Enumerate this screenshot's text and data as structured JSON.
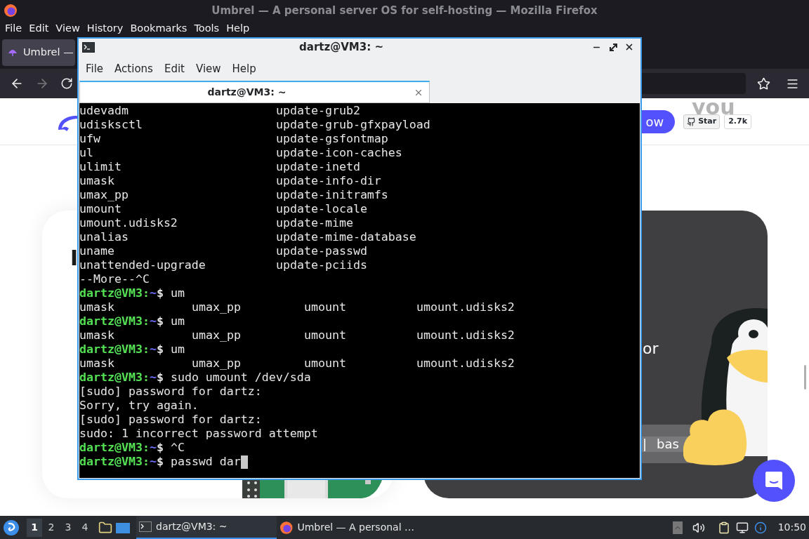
{
  "browser": {
    "title": "Umbrel — A personal server OS for self-hosting — Mozilla Firefox",
    "menu": [
      "File",
      "Edit",
      "View",
      "History",
      "Bookmarks",
      "Tools",
      "Help"
    ],
    "tab": {
      "label": "Umbrel —",
      "selected": true
    },
    "page": {
      "header": {
        "tagline": "you",
        "button": "ow",
        "star": "Star",
        "star_count": "2.7k"
      },
      "left_card": {
        "heading": [
          "I"
        ]
      },
      "right_card": {
        "text": "or",
        "command_bar": [
          "|",
          "bas"
        ]
      }
    }
  },
  "terminal": {
    "title": "dartz@VM3: ~",
    "menu": [
      "File",
      "Actions",
      "Edit",
      "View",
      "Help"
    ],
    "tab": {
      "label": "dartz@VM3: ~",
      "selected": true
    },
    "lines": [
      {
        "kind": "columns",
        "cells": [
          "udevadm",
          "update-grub2"
        ]
      },
      {
        "kind": "columns",
        "cells": [
          "udisksctl",
          "update-grub-gfxpayload"
        ]
      },
      {
        "kind": "columns",
        "cells": [
          "ufw",
          "update-gsfontmap"
        ]
      },
      {
        "kind": "columns",
        "cells": [
          "ul",
          "update-icon-caches"
        ]
      },
      {
        "kind": "columns",
        "cells": [
          "ulimit",
          "update-inetd"
        ]
      },
      {
        "kind": "columns",
        "cells": [
          "umask",
          "update-info-dir"
        ]
      },
      {
        "kind": "columns",
        "cells": [
          "umax_pp",
          "update-initramfs"
        ]
      },
      {
        "kind": "columns",
        "cells": [
          "umount",
          "update-locale"
        ]
      },
      {
        "kind": "columns",
        "cells": [
          "umount.udisks2",
          "update-mime"
        ]
      },
      {
        "kind": "columns",
        "cells": [
          "unalias",
          "update-mime-database"
        ]
      },
      {
        "kind": "columns",
        "cells": [
          "uname",
          "update-passwd"
        ]
      },
      {
        "kind": "columns",
        "cells": [
          "unattended-upgrade",
          "update-pciids"
        ]
      },
      {
        "kind": "output",
        "text": "--More--^C"
      },
      {
        "kind": "prompt",
        "host": "dartz@VM3:",
        "path": "~",
        "sign": "$",
        "command": "um"
      },
      {
        "kind": "columns",
        "cells": [
          "umask",
          "umax_pp",
          "umount",
          "umount.udisks2"
        ]
      },
      {
        "kind": "prompt",
        "host": "dartz@VM3:",
        "path": "~",
        "sign": "$",
        "command": "um"
      },
      {
        "kind": "columns",
        "cells": [
          "umask",
          "umax_pp",
          "umount",
          "umount.udisks2"
        ]
      },
      {
        "kind": "prompt",
        "host": "dartz@VM3:",
        "path": "~",
        "sign": "$",
        "command": "um"
      },
      {
        "kind": "columns",
        "cells": [
          "umask",
          "umax_pp",
          "umount",
          "umount.udisks2"
        ]
      },
      {
        "kind": "prompt",
        "host": "dartz@VM3:",
        "path": "~",
        "sign": "$",
        "command": "sudo umount /dev/sda"
      },
      {
        "kind": "output",
        "text": "[sudo] password for dartz:"
      },
      {
        "kind": "output",
        "text": "Sorry, try again."
      },
      {
        "kind": "output",
        "text": "[sudo] password for dartz:"
      },
      {
        "kind": "output",
        "text": "sudo: 1 incorrect password attempt"
      },
      {
        "kind": "prompt",
        "host": "dartz@VM3:",
        "path": "~",
        "sign": "$",
        "command": "^C"
      },
      {
        "kind": "prompt",
        "host": "dartz@VM3:",
        "path": "~",
        "sign": "$",
        "command": "passwd dar",
        "cursor": true
      }
    ]
  },
  "taskbar": {
    "workspaces": [
      {
        "label": "1",
        "selected": true
      },
      {
        "label": "2",
        "selected": false
      },
      {
        "label": "3",
        "selected": false
      },
      {
        "label": "4",
        "selected": false
      }
    ],
    "tasks": [
      {
        "kind": "terminal",
        "label": "dartz@VM3: ~",
        "selected": true
      },
      {
        "kind": "browser",
        "label": "Umbrel — A personal …",
        "selected": false
      }
    ],
    "clock": "10:50"
  }
}
